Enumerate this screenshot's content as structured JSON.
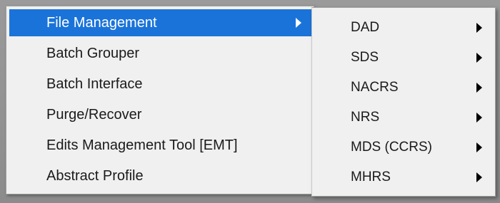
{
  "main_menu": {
    "items": [
      {
        "label": "File Management",
        "has_submenu": true,
        "selected": true
      },
      {
        "label": "Batch Grouper"
      },
      {
        "label": "Batch Interface"
      },
      {
        "label": "Purge/Recover"
      },
      {
        "label": "Edits Management Tool [EMT]"
      },
      {
        "label": "Abstract Profile"
      }
    ]
  },
  "submenu": {
    "items": [
      {
        "label": "DAD",
        "has_submenu": true
      },
      {
        "label": "SDS",
        "has_submenu": true
      },
      {
        "label": "NACRS",
        "has_submenu": true
      },
      {
        "label": "NRS",
        "has_submenu": true
      },
      {
        "label": "MDS (CCRS)",
        "has_submenu": true
      },
      {
        "label": "MHRS",
        "has_submenu": true
      }
    ]
  },
  "colors": {
    "selection": "#1a73d9",
    "menu_background": "#f0f0f0"
  },
  "icons": {
    "submenu_arrow": "triangle-right-icon"
  }
}
